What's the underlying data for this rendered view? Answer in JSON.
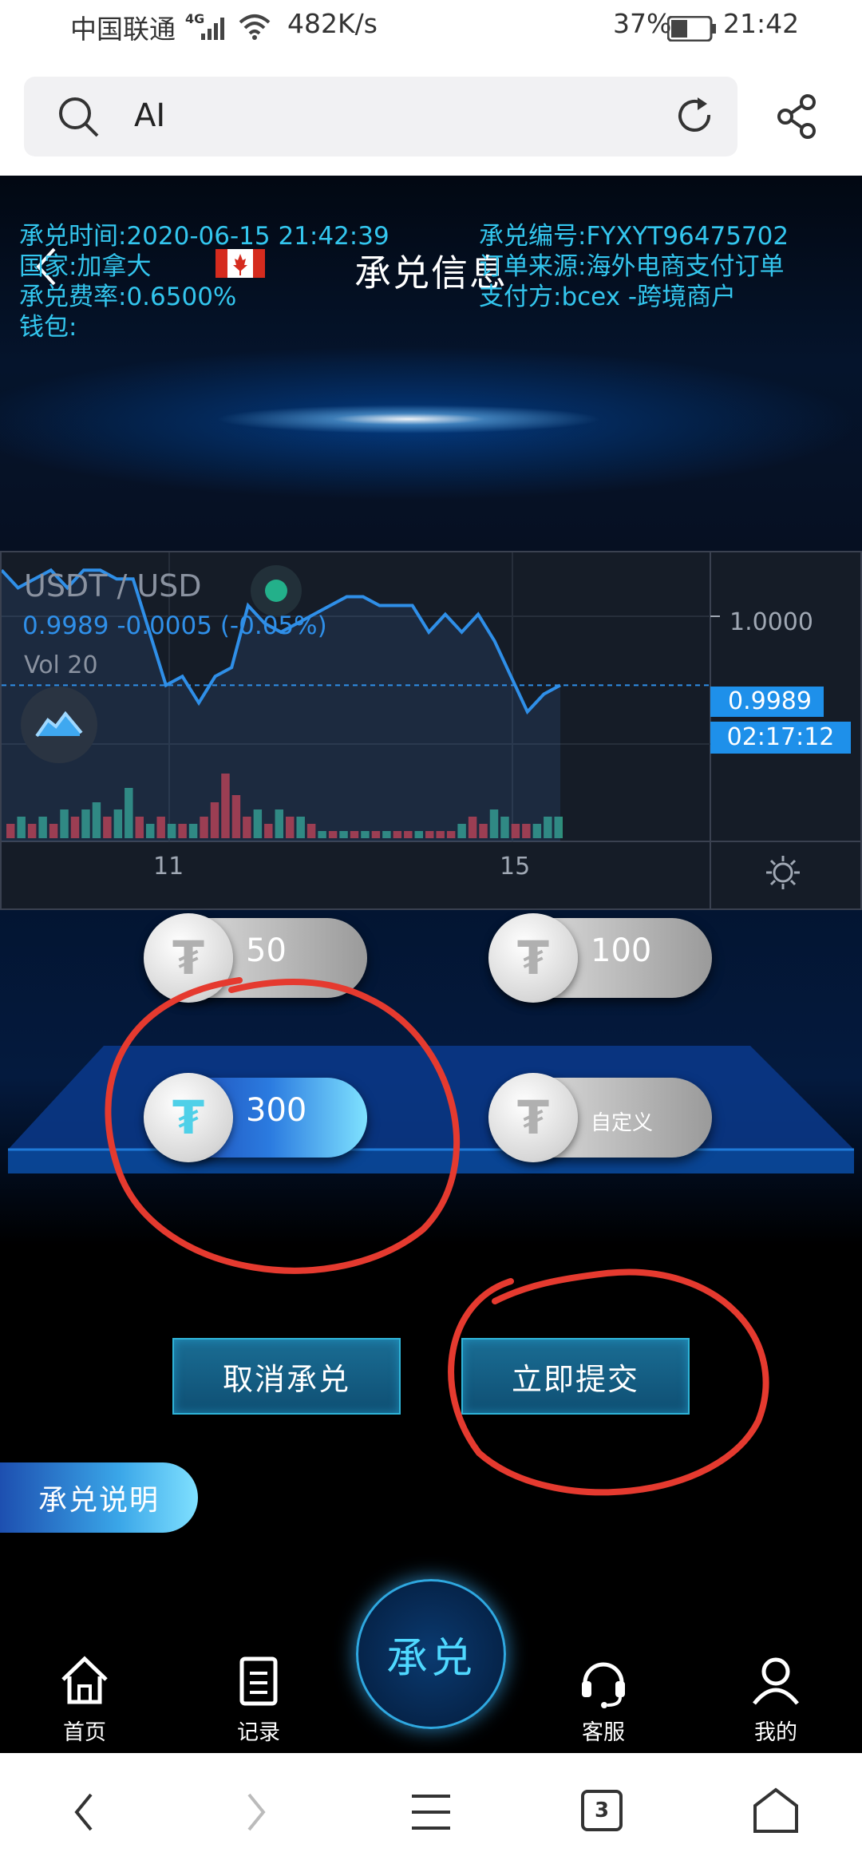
{
  "status_bar": {
    "carrier": "中国联通",
    "network": "4G",
    "speed": "482K/s",
    "battery": "37%",
    "time": "21:42"
  },
  "browser": {
    "search_text": "AI",
    "icons": [
      "search-icon",
      "refresh-icon",
      "share-icon"
    ]
  },
  "header": {
    "title": "承兑信息",
    "time_label": "承兑时间:2020-06-15 21:42:39",
    "number_label": "承兑编号:FYXYT96475702",
    "country_label": "国家:加拿大",
    "source_label": "订单来源:海外电商支付订单",
    "fee_label": "承兑费率:0.6500%",
    "payer_label": "支付方:bcex -跨境商户",
    "wallet_label": "钱包:"
  },
  "chart": {
    "pair": "USDT / USD",
    "quote": "0.9989 -0.0005 (-0.05%)",
    "volume": "Vol 20",
    "price_tick": "1.0000",
    "current_price": "0.9989",
    "countdown": "02:17:12",
    "date_ticks": [
      "11",
      "15"
    ]
  },
  "chart_data": {
    "type": "line",
    "title": "USDT / USD",
    "xlabel": "",
    "ylabel": "",
    "y_ticks": [
      "1.0000"
    ],
    "x_ticks": [
      "11",
      "15"
    ],
    "ylim": [
      0.9982,
      1.0004
    ],
    "current_value": 0.9989,
    "series": [
      {
        "values": [
          1.0002,
          1.0,
          1.0001,
          1.0002,
          1.0,
          1.0002,
          1.0002,
          1.0001,
          1.0001,
          0.9995,
          0.9989,
          0.999,
          0.9987,
          0.999,
          0.9991,
          0.9998,
          0.9996,
          0.9995,
          0.9996,
          0.9997,
          0.9998,
          0.9999,
          0.9999,
          0.9998,
          0.9998,
          0.9998,
          0.9995,
          0.9997,
          0.9995,
          0.9997,
          0.9994,
          0.999,
          0.9986,
          0.9988,
          0.9989
        ]
      }
    ],
    "volume_bars": [
      2,
      3,
      2,
      3,
      2,
      4,
      3,
      4,
      5,
      3,
      4,
      7,
      3,
      2,
      3,
      2,
      2,
      2,
      3,
      5,
      9,
      6,
      3,
      4,
      2,
      4,
      3,
      3,
      2,
      1,
      1,
      1,
      1,
      1,
      1,
      1,
      1,
      1,
      1,
      1,
      1,
      1,
      2,
      3,
      2,
      4,
      3,
      2,
      2,
      2,
      3,
      3
    ],
    "volume_bar_up": [
      false,
      true,
      false,
      true,
      false,
      true,
      false,
      true,
      true,
      false,
      true,
      true,
      false,
      true,
      false,
      true,
      false,
      true,
      false,
      false,
      false,
      false,
      false,
      true,
      false,
      true,
      false,
      true,
      false,
      true,
      false,
      true,
      false,
      true,
      false,
      true,
      false,
      false,
      true,
      false,
      false,
      false,
      true,
      false,
      false,
      true,
      true,
      false,
      false,
      true,
      true,
      true
    ]
  },
  "choices": {
    "opt50": "50",
    "opt100": "100",
    "opt300": "300",
    "custom": "自定义"
  },
  "actions": {
    "cancel": "取消承兑",
    "submit": "立即提交",
    "help": "承兑说明"
  },
  "tabs": {
    "home": "首页",
    "records": "记录",
    "center": "承兑",
    "service": "客服",
    "mine": "我的"
  },
  "nav": {
    "tab_count": "3"
  },
  "colors": {
    "accent_cyan": "#33c6ee",
    "chart_line": "#2f8fe8",
    "annotation_red": "#e53a2f",
    "volume_up": "#2e8f7a",
    "volume_down": "#b0343f"
  }
}
